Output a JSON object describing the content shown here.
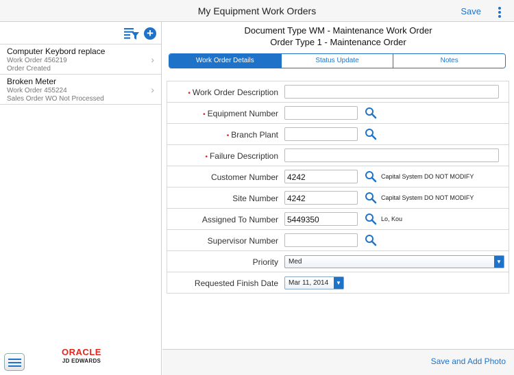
{
  "header": {
    "title": "My Equipment Work Orders",
    "save_label": "Save"
  },
  "sidebar": {
    "items": [
      {
        "title": "Computer Keybord replace",
        "line1": "Work Order 456219",
        "line2": "Order Created"
      },
      {
        "title": "Broken Meter",
        "line1": "Work Order 455224",
        "line2": "Sales Order WO Not Processed"
      }
    ],
    "logo_top": "ORACLE",
    "logo_bottom": "JD EDWARDS"
  },
  "main": {
    "doc_type": "Document Type WM - Maintenance Work Order",
    "order_type": "Order Type 1 - Maintenance Order",
    "tabs": [
      {
        "label": "Work Order Details"
      },
      {
        "label": "Status Update"
      },
      {
        "label": "Notes"
      }
    ]
  },
  "form": {
    "work_order_description": {
      "label": "Work Order Description",
      "required": true,
      "value": ""
    },
    "equipment_number": {
      "label": "Equipment Number",
      "required": true,
      "value": ""
    },
    "branch_plant": {
      "label": "Branch Plant",
      "required": true,
      "value": ""
    },
    "failure_description": {
      "label": "Failure Description",
      "required": true,
      "value": ""
    },
    "customer_number": {
      "label": "Customer Number",
      "value": "4242",
      "desc": "Capital System DO NOT MODIFY"
    },
    "site_number": {
      "label": "Site Number",
      "value": "4242",
      "desc": "Capital System DO NOT MODIFY"
    },
    "assigned_to_number": {
      "label": "Assigned To Number",
      "value": "5449350",
      "desc": "Lo, Kou"
    },
    "supervisor_number": {
      "label": "Supervisor Number",
      "value": ""
    },
    "priority": {
      "label": "Priority",
      "value": "Med"
    },
    "requested_finish_date": {
      "label": "Requested Finish Date",
      "value": "Mar 11, 2014"
    }
  },
  "footer": {
    "action_label": "Save and Add Photo"
  },
  "colors": {
    "accent": "#1e73c8",
    "required": "#d3232a",
    "oracle_red": "#e1261c"
  },
  "icons": [
    "filter-list-icon",
    "add-icon",
    "chevron-right-icon",
    "magnifier-icon",
    "hamburger-menu-icon",
    "kebab-menu-icon"
  ]
}
